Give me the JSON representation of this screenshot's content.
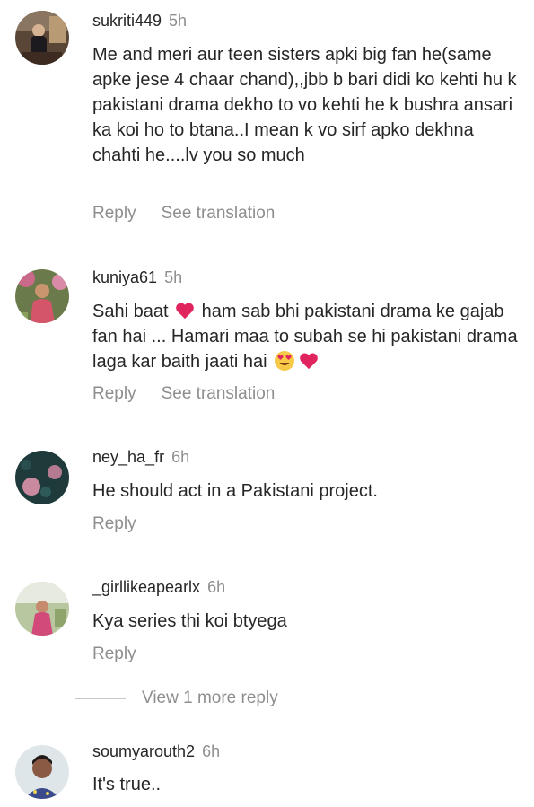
{
  "comments": [
    {
      "username": "sukriti449",
      "time": "5h",
      "text": "Me and meri aur teen sisters apki big fan he(same apke jese 4 chaar chand),,jbb b bari didi ko kehti hu k pakistani drama dekho to vo kehti he k bushra ansari ka koi ho to btana..I mean k vo sirf apko dekhna chahti he....lv you so much",
      "reply": "Reply",
      "see_translation": "See translation"
    },
    {
      "username": "kuniya61",
      "time": "5h",
      "text_part1": "Sahi baat",
      "text_part2": "ham sab bhi pakistani drama ke gajab fan hai ... Hamari maa to subah se hi pakistani drama laga kar baith jaati hai",
      "reply": "Reply",
      "see_translation": "See translation",
      "emojis": [
        "red-heart",
        "heart-eyes",
        "red-heart"
      ]
    },
    {
      "username": "ney_ha_fr",
      "time": "6h",
      "text": "He should act in a Pakistani project.",
      "reply": "Reply"
    },
    {
      "username": "_girllikeapearlx",
      "time": "6h",
      "text": "Kya series thi koi btyega",
      "reply": "Reply"
    },
    {
      "username": "soumyarouth2",
      "time": "6h",
      "text": "It's true.."
    }
  ],
  "view_more": "View 1 more reply",
  "colors": {
    "text": "#262626",
    "secondary": "#8e8e8e",
    "heart": "#e0245e"
  }
}
